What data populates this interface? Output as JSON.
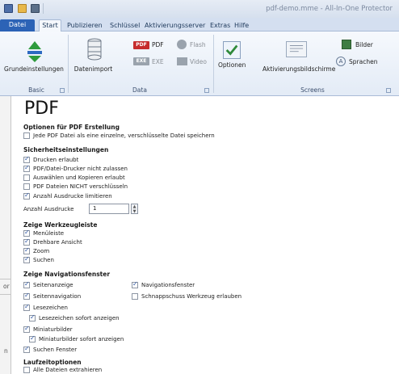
{
  "window": {
    "title": "pdf-demo.mme - All-In-One Protector"
  },
  "tabs": [
    "Datei",
    "Start",
    "Publizieren",
    "Schlüssel",
    "Aktivierungsserver",
    "Extras",
    "Hilfe"
  ],
  "ribbon": {
    "grundeinstellungen": "Grundeinstellungen",
    "datenimport": "Datenimport",
    "pdf": "PDF",
    "exe": "EXE",
    "flash": "Flash",
    "video": "Video",
    "optionen": "Optionen",
    "aktivierungsbildschirme": "Aktivierungsbildschirme",
    "bilder": "Bilder",
    "sprachen": "Sprachen",
    "pdf_badge": "PDF",
    "exe_badge": "EXE",
    "sprachen_glyph": "A",
    "groups": {
      "basic": "Basic",
      "data": "Data",
      "screens": "Screens"
    }
  },
  "left_bleed": {
    "text1": "or",
    "text2": "n"
  },
  "page": {
    "title": "PDF",
    "s1": {
      "heading": "Optionen für PDF Erstellung",
      "items": [
        {
          "label": "Jede PDF Datei als eine einzelne, verschlüsselte Datei speichern",
          "checked": false
        }
      ]
    },
    "s2": {
      "heading": "Sicherheitseinstellungen",
      "items": [
        {
          "label": "Drucken erlaubt",
          "checked": true
        },
        {
          "label": "PDF/Datei-Drucker nicht zulassen",
          "checked": true
        },
        {
          "label": "Auswählen und Kopieren erlaubt",
          "checked": false
        },
        {
          "label": "PDF Dateien NICHT verschlüsseln",
          "checked": false
        },
        {
          "label": "Anzahl Ausdrucke limitieren",
          "checked": true
        }
      ],
      "count_label": "Anzahl Ausdrucke",
      "count_value": "1"
    },
    "s3": {
      "heading": "Zeige Werkzeugleiste",
      "items": [
        {
          "label": "Menüleiste",
          "checked": true
        },
        {
          "label": "Drehbare Ansicht",
          "checked": true
        },
        {
          "label": "Zoom",
          "checked": true
        },
        {
          "label": "Suchen",
          "checked": true
        }
      ]
    },
    "s4": {
      "heading": "Zeige Navigationsfenster",
      "items": [
        {
          "label": "Seitenanzeige",
          "checked": true
        },
        {
          "label": "Seitennavigation",
          "checked": true
        },
        {
          "label": "Lesezeichen",
          "checked": true
        },
        {
          "label": "Lesezeichen sofort anzeigen",
          "checked": true
        },
        {
          "label": "Miniaturbilder",
          "checked": true
        },
        {
          "label": "Miniaturbilder sofort anzeigen",
          "checked": true
        },
        {
          "label": "Suchen Fenster",
          "checked": true
        },
        {
          "label": "Navigationsfenster",
          "checked": true
        },
        {
          "label": "Schnappschuss Werkzeug erlauben",
          "checked": false
        }
      ]
    },
    "s5": {
      "heading": "Laufzeitoptionen",
      "items": [
        {
          "label": "Alle Dateien extrahieren",
          "checked": false
        }
      ]
    }
  }
}
